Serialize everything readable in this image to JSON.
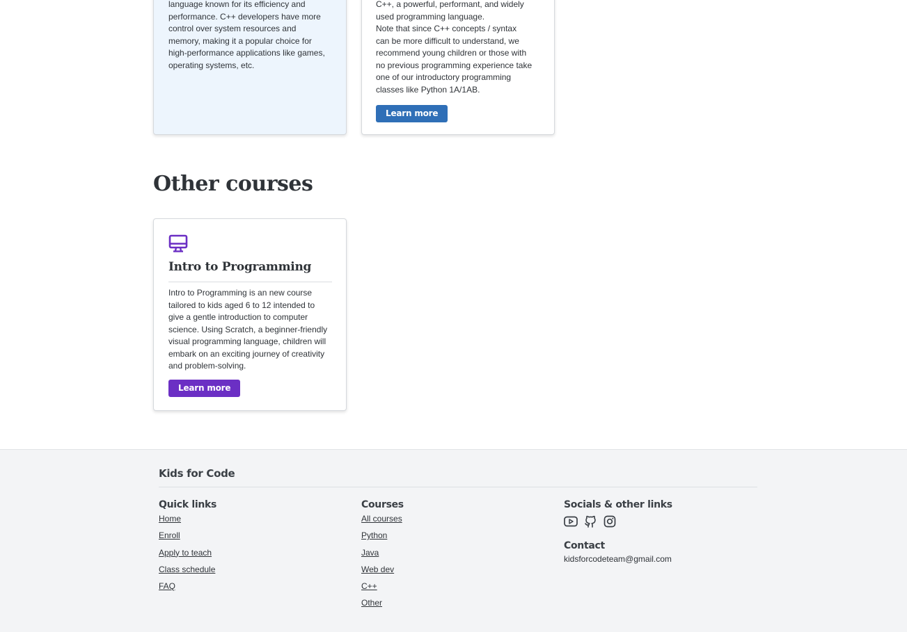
{
  "colors": {
    "accent_blue": "#2f6fb7",
    "accent_purple": "#6b2fc4",
    "card_blue_bg": "#edf5fd",
    "footer_bg": "#f3f4f6",
    "text": "#2f3338"
  },
  "cpp_card_blue": {
    "lines": [
      "language known for its efficiency and",
      "performance. C++ developers have more",
      "control over system resources and",
      "memory, making it a popular choice for",
      "high-performance applications like games,",
      "operating systems, etc."
    ]
  },
  "cpp_card_white": {
    "lines": [
      "C++, a powerful, performant, and widely",
      "used programming language.",
      "Note that since C++ concepts / syntax",
      "can be more difficult to understand, we",
      "recommend young children or those with",
      "no previous programming experience take",
      "one of our introductory programming",
      "classes like Python 1A/1AB."
    ],
    "button_label": "Learn more"
  },
  "other_courses": {
    "title": "Other courses",
    "card": {
      "icon": "monitor-icon",
      "title": "Intro to Programming",
      "lines": [
        "Intro to Programming is an new course",
        "tailored to kids aged 6 to 12 intended to",
        "give a gentle introduction to computer",
        "science. Using Scratch, a beginner-friendly",
        "visual programming language, children will",
        "embark on an exciting journey of creativity",
        "and problem-solving."
      ],
      "button_label": "Learn more"
    }
  },
  "footer": {
    "brand": "Kids for Code",
    "quick_links": {
      "title": "Quick links",
      "items": [
        "Home",
        "Enroll",
        "Apply to teach",
        "Class schedule",
        "FAQ"
      ]
    },
    "courses": {
      "title": "Courses",
      "items": [
        "All courses",
        "Python",
        "Java",
        "Web dev",
        "C++",
        "Other"
      ]
    },
    "socials": {
      "title": "Socials & other links",
      "icons": [
        "youtube-icon",
        "github-icon",
        "instagram-icon"
      ]
    },
    "contact": {
      "title": "Contact",
      "email": "kidsforcodeteam@gmail.com"
    }
  }
}
